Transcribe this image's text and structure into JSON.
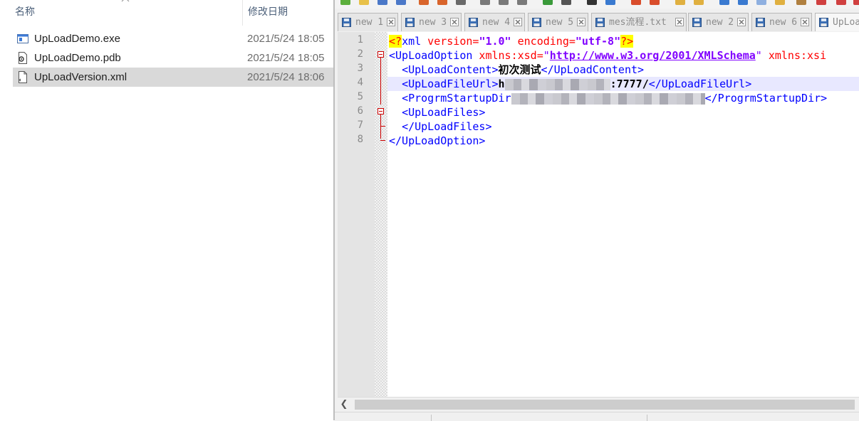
{
  "explorer": {
    "columns": {
      "name": "名称",
      "date_modified": "修改日期"
    },
    "files": [
      {
        "name": "UpLoadDemo.exe",
        "date": "2021/5/24 18:05",
        "icon": "exe-file-icon",
        "selected": false
      },
      {
        "name": "UpLoadDemo.pdb",
        "date": "2021/5/24 18:05",
        "icon": "pdb-file-icon",
        "selected": false
      },
      {
        "name": "UpLoadVersion.xml",
        "date": "2021/5/24 18:06",
        "icon": "xml-file-icon",
        "selected": true
      }
    ]
  },
  "notepad": {
    "tabs": [
      {
        "label": "new 1",
        "active": false
      },
      {
        "label": "new 3",
        "active": false
      },
      {
        "label": "new 4",
        "active": false
      },
      {
        "label": "new 5",
        "active": false
      },
      {
        "label": "mes流程.txt",
        "active": false
      },
      {
        "label": "new 2",
        "active": false
      },
      {
        "label": "new 6",
        "active": false
      },
      {
        "label": "UpLoa",
        "active": true
      }
    ],
    "line_numbers": [
      "1",
      "2",
      "3",
      "4",
      "5",
      "6",
      "7",
      "8"
    ],
    "current_line": 4,
    "code": {
      "line1": {
        "open": "<?",
        "xml": "xml",
        "version_attr": " version=",
        "version_val": "\"1.0\"",
        "encoding_attr": " encoding=",
        "encoding_val": "\"utf-8\"",
        "close": "?>"
      },
      "line2": {
        "tag": "<UpLoadOption",
        "xsd_attr": " xmlns:xsd=",
        "q1": "\"",
        "url": "http://www.w3.org/2001/XMLSchema",
        "q2": "\"",
        "xsi_attr": " xmlns:xsi"
      },
      "line3": {
        "open": "<UpLoadContent>",
        "text": "初次测试",
        "close": "</UpLoadContent>"
      },
      "line4": {
        "open": "<UpLoadFileUrl>",
        "text_start": "h",
        "text_end": ":7777/",
        "close": "</UpLoadFileUrl>"
      },
      "line5": {
        "open": "<ProgrmStartupDir",
        "close": "</ProgrmStartupDir>"
      },
      "line6": {
        "open": "<UpLoadFiles>"
      },
      "line7": {
        "close": "</UpLoadFiles>"
      },
      "line8": {
        "close": "</UpLoadOption>"
      }
    },
    "colors": {
      "tag": "#0000ff",
      "attribute": "#ff0000",
      "value": "#8000ff",
      "pi_highlight": "#ffff00",
      "current_line": "#e8e8ff",
      "fold_marker": "#cc0000"
    }
  }
}
